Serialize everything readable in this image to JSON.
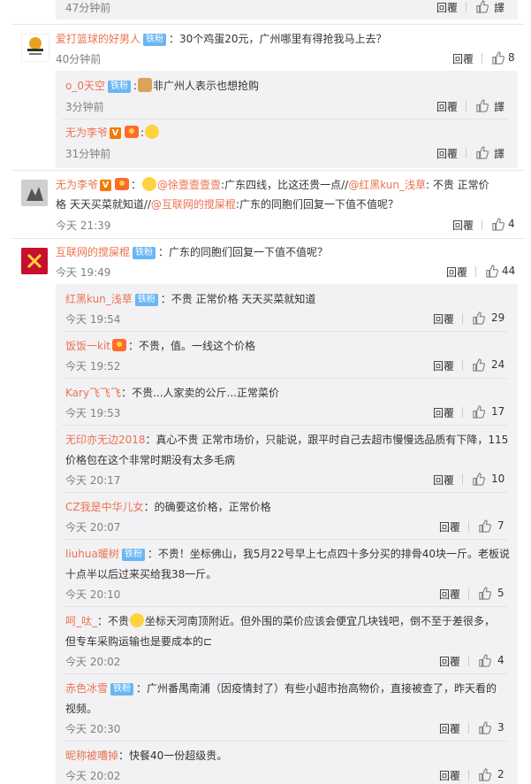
{
  "ui": {
    "reply": "回覆",
    "translate": "譯"
  },
  "top": {
    "time": "47分钟前",
    "reply": "回覆",
    "right": "譯"
  },
  "c1": {
    "name": "爱打篮球的好男人",
    "badge": "铁粉",
    "text": "：30个鸡蛋20元，广州哪里有得抢我马上去？",
    "time": "40分钟前",
    "likes": "8",
    "replies": [
      {
        "name": "o_0天空",
        "badge": "铁粉",
        "text": "非广州人表示也想抢购",
        "time": "3分钟前",
        "right": "譯"
      },
      {
        "name": "无为李爷",
        "badge_v": "V",
        "text": "",
        "time": "31分钟前",
        "right": "譯"
      }
    ]
  },
  "c2": {
    "name": "无为李爷",
    "badge_v": "V",
    "line1_pre": "：",
    "m1": "@徐壹壹壹壹",
    "t1": ":广东四线，比这还贵一点//",
    "m2": "@红黑kun_浅草",
    "t2": ": 不贵  正常价",
    "line2_a": "格  天天买菜就知道//",
    "m3": "@互联网的搅屎棍",
    "t3": ":广东的同胞们回复一下值不值呢？",
    "time": "今天 21:39",
    "likes": "4"
  },
  "c3": {
    "name": "互联网的搅屎棍",
    "badge": "铁粉",
    "text": "：广东的同胞们回复一下值不值呢？",
    "time": "今天 19:49",
    "likes": "44",
    "replies": [
      {
        "name": "红黑kun_浅草",
        "badge": "铁粉",
        "text": "：不贵  正常价格  天天买菜就知道",
        "time": "今天 19:54",
        "likes": "29"
      },
      {
        "name": "饭饭一kit",
        "text": "：不贵，值。一线这个价格",
        "time": "今天 19:52",
        "likes": "24"
      },
      {
        "name": "Kary飞飞飞",
        "text": "：不贵...人家卖的公斤...正常菜价",
        "time": "今天 19:53",
        "likes": "17"
      },
      {
        "name": "无印亦无边2018",
        "text": "：真心不贵 正常市场价，只能说，跟平时自己去超市慢慢选品质有下降，115",
        "text2": "价格包在这个非常时期没有太多毛病",
        "time": "今天 20:17",
        "likes": "10"
      },
      {
        "name": "CZ我是中华儿女",
        "text": "：的确要这价格，正常价格",
        "time": "今天 20:07",
        "likes": "7"
      },
      {
        "name": "liuhua暖树",
        "badge": "铁粉",
        "text": "：不贵！坐标佛山，我5月22号早上七点四十多分买的排骨40块一斤。老板说",
        "text2": "十点半以后过来买给我38一斤。",
        "time": "今天 20:10",
        "likes": "5"
      },
      {
        "name": "呵_呔_",
        "text_a": "：不贵",
        "text": "坐标天河南顶附近。但外围的菜价应该会便宜几块钱吧，倒不至于差很多，",
        "text2": "但专车采购运输也是要成本的⊏",
        "time": "今天 20:02",
        "likes": "4"
      },
      {
        "name": "赤色冰雪",
        "badge": "铁粉",
        "text": "：广州番禺南浦（因疫情封了）有些小超市抬高物价，直接被查了，昨天看的",
        "text2": "视频。",
        "time": "今天 20:30",
        "likes": "3"
      },
      {
        "name": "昵称被嘈掉",
        "text": "：快餐40一份超级贵。",
        "time": "今天 20:02",
        "likes": "2"
      }
    ]
  }
}
